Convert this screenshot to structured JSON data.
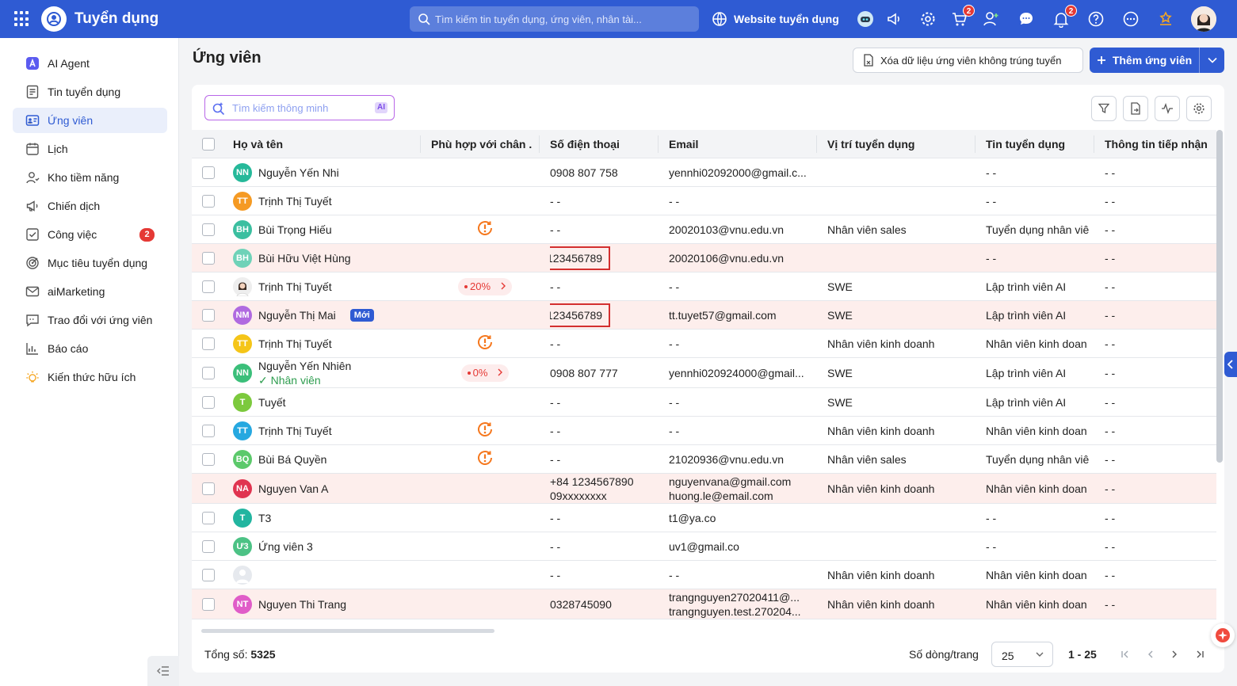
{
  "app": {
    "title": "Tuyển dụng"
  },
  "topbar": {
    "search_placeholder": "Tìm kiếm tin tuyển dụng, ứng viên, nhân tài...",
    "website_label": "Website tuyển dụng",
    "cart_badge": "2",
    "bell_badge": "2"
  },
  "sidebar": {
    "items": [
      {
        "label": "AI Agent",
        "icon": "ai-agent-icon"
      },
      {
        "label": "Tin tuyển dụng",
        "icon": "job-post-icon"
      },
      {
        "label": "Ứng viên",
        "icon": "candidate-card-icon",
        "active": true
      },
      {
        "label": "Lịch",
        "icon": "calendar-icon"
      },
      {
        "label": "Kho tiềm năng",
        "icon": "talent-pool-icon"
      },
      {
        "label": "Chiến dịch",
        "icon": "megaphone-icon"
      },
      {
        "label": "Công việc",
        "icon": "task-check-icon",
        "badge": "2"
      },
      {
        "label": "Mục tiêu tuyển dụng",
        "icon": "target-icon"
      },
      {
        "label": "aiMarketing",
        "icon": "mail-marketing-icon"
      },
      {
        "label": "Trao đổi với ứng viên",
        "icon": "chat-icon"
      },
      {
        "label": "Báo cáo",
        "icon": "report-chart-icon"
      },
      {
        "label": "Kiến thức hữu ích",
        "icon": "lightbulb-icon"
      }
    ]
  },
  "page": {
    "title": "Ứng viên",
    "btn_clear": "Xóa dữ liệu ứng viên không trúng tuyển",
    "btn_add": "Thêm ứng viên",
    "smart_search_placeholder": "Tìm kiếm thông minh",
    "ai_chip": "AI"
  },
  "table": {
    "columns": [
      "Họ và tên",
      "Phù hợp với chân ...",
      "Số điện thoại",
      "Email",
      "Vị trí tuyển dụng",
      "Tin tuyển dụng",
      "Thông tin tiếp nhận"
    ],
    "rows": [
      {
        "initials": "NN",
        "color": "#26b99a",
        "name": "Nguyễn Yến Nhi",
        "phone": "0908 807 758",
        "email": "yennhi02092000@gmail.c...",
        "position": "",
        "job": "- -",
        "info": "- -"
      },
      {
        "initials": "TT",
        "color": "#f59a23",
        "name": "Trịnh Thị Tuyết",
        "phone": "- -",
        "email": "- -",
        "position": "",
        "job": "- -",
        "info": "- -"
      },
      {
        "initials": "BH",
        "color": "#3bbfa0",
        "name": "Bùi Trọng Hiếu",
        "match_icon": true,
        "phone": "- -",
        "email": "20020103@vnu.edu.vn",
        "position": "Nhân viên sales",
        "job": "Tuyển dụng nhân viê",
        "info": "- -"
      },
      {
        "initials": "BH",
        "color": "#6fd2b8",
        "name": "Bùi Hữu Việt Hùng",
        "phone": "123456789",
        "phone_box": true,
        "email": "20020106@vnu.edu.vn",
        "position": "",
        "job": "- -",
        "info": "- -",
        "highlight": true
      },
      {
        "photo": true,
        "name": "Trịnh Thị Tuyết",
        "match": "20%",
        "phone": "- -",
        "email": "- -",
        "position": "SWE",
        "job": "Lập trình viên AI",
        "info": "- -"
      },
      {
        "initials": "NM",
        "color": "#b06ae0",
        "name": "Nguyễn Thị Mai",
        "new_badge": "Mới",
        "phone": "123456789",
        "phone_box": true,
        "email": "tt.tuyet57@gmail.com",
        "position": "SWE",
        "job": "Lập trình viên AI",
        "info": "- -",
        "highlight": true
      },
      {
        "initials": "TT",
        "color": "#f5c518",
        "name": "Trịnh Thị Tuyết",
        "match_icon": true,
        "phone": "- -",
        "email": "- -",
        "position": "Nhân viên kinh doanh",
        "job": "Nhân viên kinh doan",
        "info": "- -"
      },
      {
        "initials": "NN",
        "color": "#3bbf7a",
        "name": "Nguyễn Yến Nhiên",
        "sub": "Nhân viên",
        "match": "0%",
        "phone": "0908 807 777",
        "email": "yennhi020924000@gmail...",
        "position": "SWE",
        "job": "Lập trình viên AI",
        "info": "- -"
      },
      {
        "initials": "T",
        "color": "#7cc93d",
        "name": "Tuyết",
        "phone": "- -",
        "email": "- -",
        "position": "SWE",
        "job": "Lập trình viên AI",
        "info": "- -"
      },
      {
        "initials": "TT",
        "color": "#26a8e0",
        "name": "Trịnh Thị Tuyết",
        "match_icon": true,
        "phone": "- -",
        "email": "- -",
        "position": "Nhân viên kinh doanh",
        "job": "Nhân viên kinh doan",
        "info": "- -"
      },
      {
        "initials": "BQ",
        "color": "#5cc96b",
        "name": "Bùi Bá Quyền",
        "match_icon": true,
        "phone": "- -",
        "email": "21020936@vnu.edu.vn",
        "position": "Nhân viên sales",
        "job": "Tuyển dụng nhân viê",
        "info": "- -"
      },
      {
        "initials": "NA",
        "color": "#e03450",
        "name": "Nguyen Van A",
        "phone": "+84 1234567890",
        "phone2": "09xxxxxxxx",
        "email": "nguyenvana@gmail.com",
        "email2": "huong.le@email.com",
        "position": "Nhân viên kinh doanh",
        "job": "Nhân viên kinh doan",
        "info": "- -",
        "highlight": true
      },
      {
        "initials": "T",
        "color": "#22b5a0",
        "name": "T3",
        "phone": "- -",
        "email": "t1@ya.co",
        "position": "",
        "job": "- -",
        "info": "- -"
      },
      {
        "initials": "Ư3",
        "color": "#4cc285",
        "name": "Ứng viên 3",
        "phone": "- -",
        "email": "uv1@gmail.co",
        "position": "",
        "job": "- -",
        "info": "- -"
      },
      {
        "blank_avatar": true,
        "name": "",
        "phone": "- -",
        "email": "- -",
        "position": "Nhân viên kinh doanh",
        "job": "Nhân viên kinh doan",
        "info": "- -"
      },
      {
        "initials": "NT",
        "color": "#e05cc8",
        "name": "Nguyen Thi Trang",
        "phone": "0328745090",
        "email": "trangnguyen27020411@...",
        "email2": "trangnguyen.test.270204...",
        "position": "Nhân viên kinh doanh",
        "job": "Nhân viên kinh doan",
        "info": "- -",
        "highlight": true
      }
    ]
  },
  "footer": {
    "total_label": "Tổng số:",
    "total_value": "5325",
    "rows_per_page_label": "Số dòng/trang",
    "rows_per_page": "25",
    "range": "1 - 25"
  }
}
